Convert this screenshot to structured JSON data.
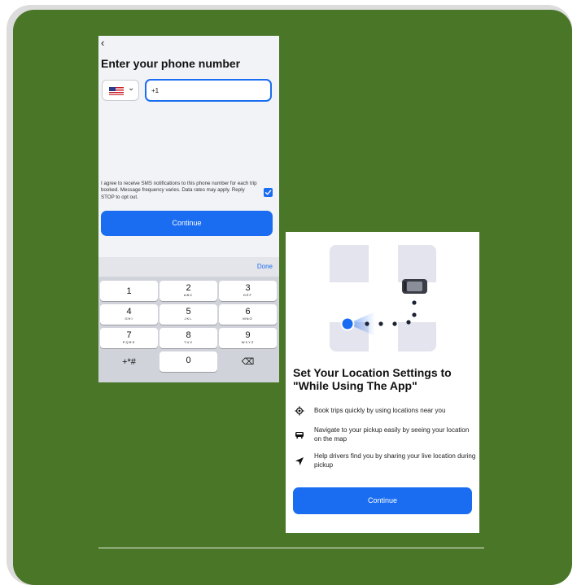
{
  "phone_screen": {
    "back_glyph": "‹",
    "title": "Enter your phone number",
    "country_chevron": "⌄",
    "phone_value": "+1",
    "consent_text": "I agree to receive SMS notifications to this phone number for each trip booked. Message frequency varies. Data rates may apply. Reply STOP to opt out.",
    "consent_checked": true,
    "continue_label": "Continue",
    "keyboard": {
      "done_label": "Done",
      "keys": [
        {
          "num": "1",
          "sub": ""
        },
        {
          "num": "2",
          "sub": "ABC"
        },
        {
          "num": "3",
          "sub": "DEF"
        },
        {
          "num": "4",
          "sub": "GHI"
        },
        {
          "num": "5",
          "sub": "JKL"
        },
        {
          "num": "6",
          "sub": "MNO"
        },
        {
          "num": "7",
          "sub": "PQRS"
        },
        {
          "num": "8",
          "sub": "TUV"
        },
        {
          "num": "9",
          "sub": "WXYZ"
        },
        {
          "num": "+*#",
          "sub": ""
        },
        {
          "num": "0",
          "sub": ""
        },
        {
          "num": "⌫",
          "sub": ""
        }
      ]
    }
  },
  "location_screen": {
    "title": "Set Your Location Settings to \"While Using The App\"",
    "features": [
      {
        "icon": "location-target-icon",
        "text": "Book trips quickly by using locations near you"
      },
      {
        "icon": "car-icon",
        "text": "Navigate to your pickup easily by seeing your location on the map"
      },
      {
        "icon": "navigation-arrow-icon",
        "text": "Help drivers find you by sharing your live location during pickup"
      }
    ],
    "continue_label": "Continue"
  },
  "colors": {
    "background_green": "#4a7628",
    "accent_blue": "#1a6cf0",
    "frame_gray": "#dcdcdc"
  }
}
